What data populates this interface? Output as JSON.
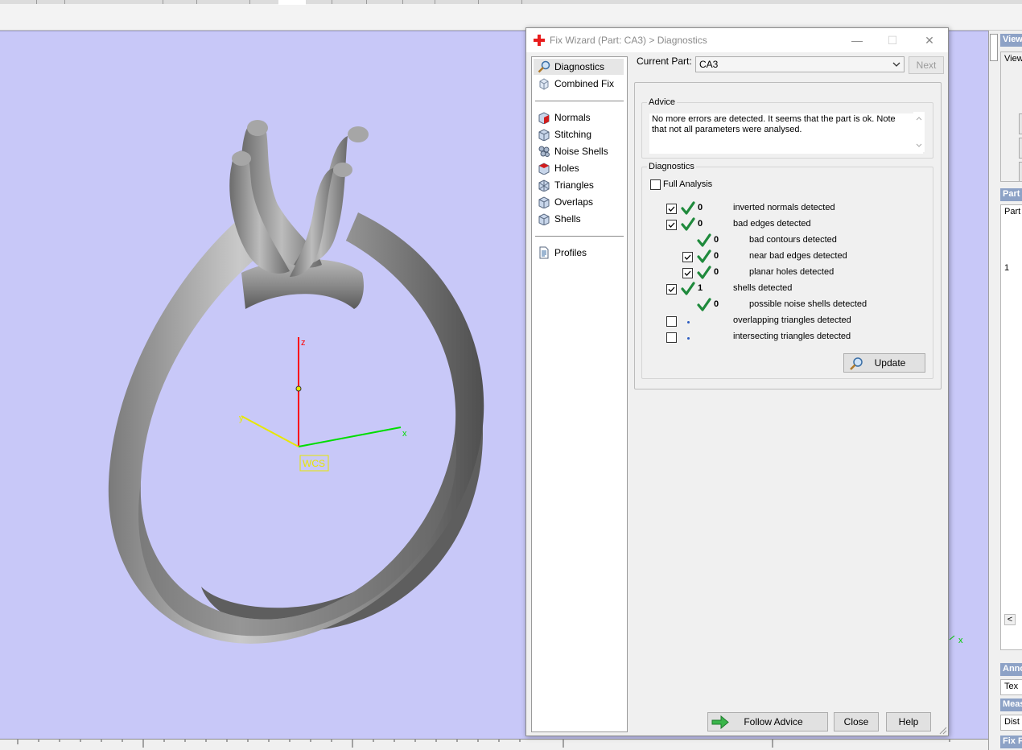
{
  "dialog": {
    "title": "Fix Wizard (Part: CA3) > Diagnostics",
    "minimize": "—",
    "maximize": "☐",
    "close": "✕",
    "nav": {
      "top": [
        "Diagnostics",
        "Combined Fix"
      ],
      "middle": [
        "Normals",
        "Stitching",
        "Noise Shells",
        "Holes",
        "Triangles",
        "Overlaps",
        "Shells"
      ],
      "bottom": [
        "Profiles"
      ]
    },
    "current_part_label": "Current Part:",
    "current_part_value": "CA3",
    "next_button": "Next",
    "advice": {
      "legend": "Advice",
      "text": "No more errors are detected. It seems that the part is ok. Note that not all parameters were analysed."
    },
    "diagnostics": {
      "legend": "Diagnostics",
      "full_analysis_label": "Full Analysis",
      "rows": [
        {
          "count": "0",
          "text": "inverted normals detected"
        },
        {
          "count": "0",
          "text": "bad edges detected"
        },
        {
          "count": "0",
          "text": "bad contours detected"
        },
        {
          "count": "0",
          "text": "near bad edges detected"
        },
        {
          "count": "0",
          "text": "planar holes detected"
        },
        {
          "count": "1",
          "text": "shells detected"
        },
        {
          "count": "0",
          "text": "possible noise shells detected"
        },
        {
          "count": "",
          "text": "overlapping triangles detected"
        },
        {
          "count": "",
          "text": "intersecting triangles detected"
        }
      ],
      "update_button": "Update"
    },
    "follow_advice_button": "Follow Advice",
    "close_button": "Close",
    "help_button": "Help"
  },
  "viewport": {
    "axis_z": "z",
    "axis_y": "y",
    "axis_x": "x",
    "wcs_label": "WCS"
  },
  "right_panel": {
    "headers": [
      "View",
      "Part",
      "Anno",
      "Meas",
      "Fix F"
    ],
    "boxes": [
      "View",
      "Part",
      "Tex",
      "Dist"
    ],
    "row_number": "1",
    "scroll_left": "<"
  },
  "colors": {
    "viewport_bg": "#c8c8f8",
    "check_green": "#1f8a3c",
    "panel_header": "#8da2c6",
    "axis_z": "#ff0000",
    "axis_x": "#00dd00",
    "axis_y": "#e8e800"
  }
}
